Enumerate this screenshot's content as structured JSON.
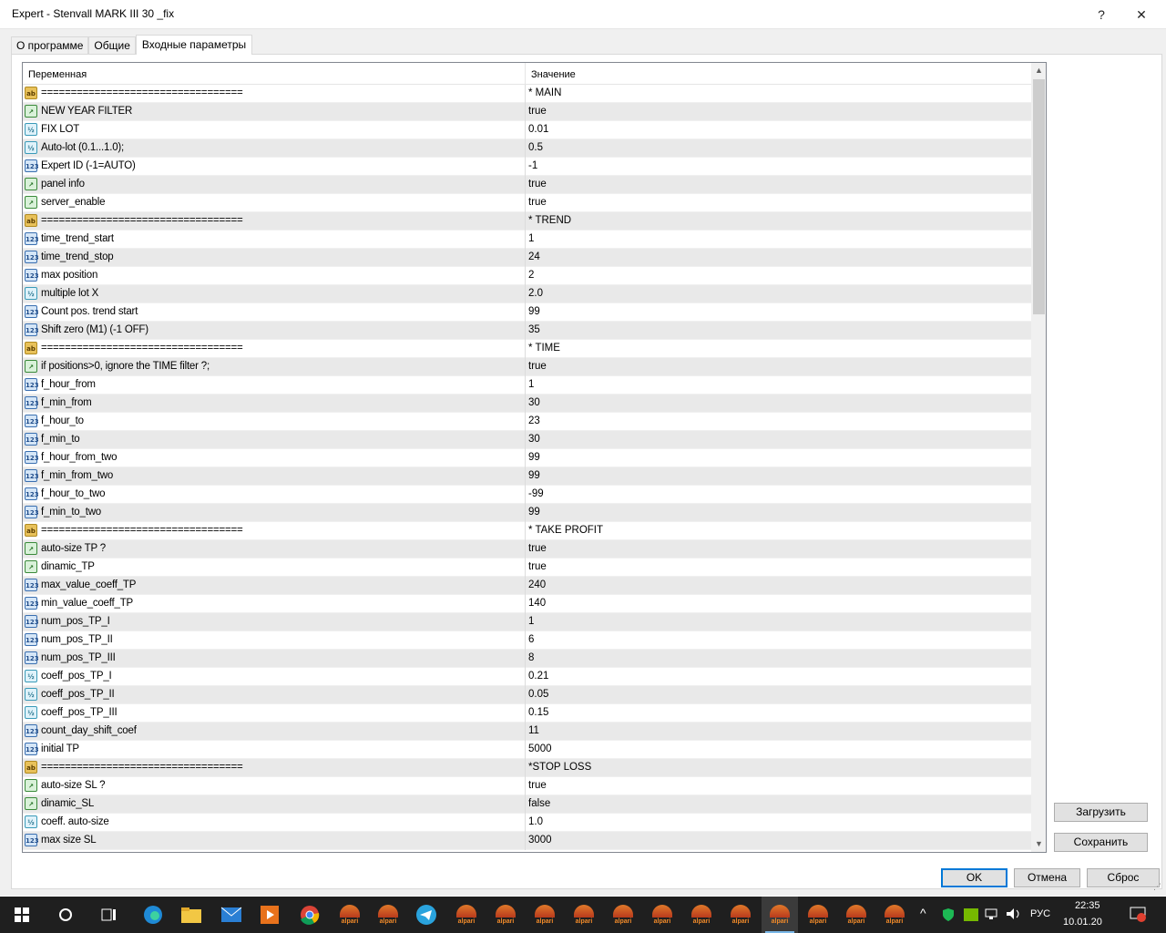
{
  "window": {
    "title": "Expert - Stenvall MARK III 30 _fix",
    "help_label": "?",
    "close_label": "✕"
  },
  "tabs": [
    {
      "label": "О программе"
    },
    {
      "label": "Общие"
    },
    {
      "label": "Входные параметры"
    }
  ],
  "grid": {
    "col_variable": "Переменная",
    "col_value": "Значение",
    "rows": [
      {
        "type": "ab",
        "name": "==================================",
        "value": "* MAIN"
      },
      {
        "type": "bool",
        "name": "NEW YEAR FILTER",
        "value": "true"
      },
      {
        "type": "dbl",
        "name": "FIX LOT",
        "value": "0.01"
      },
      {
        "type": "dbl",
        "name": "Auto-lot (0.1...1.0);",
        "value": "0.5"
      },
      {
        "type": "int",
        "name": "Expert ID (-1=AUTO)",
        "value": "-1"
      },
      {
        "type": "bool",
        "name": "panel info",
        "value": "true"
      },
      {
        "type": "bool",
        "name": "server_enable",
        "value": "true"
      },
      {
        "type": "ab",
        "name": "==================================",
        "value": "* TREND"
      },
      {
        "type": "int",
        "name": "time_trend_start",
        "value": "1"
      },
      {
        "type": "int",
        "name": "time_trend_stop",
        "value": "24"
      },
      {
        "type": "int",
        "name": "max position",
        "value": "2"
      },
      {
        "type": "dbl",
        "name": "multiple lot X",
        "value": "2.0"
      },
      {
        "type": "int",
        "name": "Count pos. trend start",
        "value": "99"
      },
      {
        "type": "int",
        "name": "Shift zero (M1) (-1 OFF)",
        "value": "35"
      },
      {
        "type": "ab",
        "name": "==================================",
        "value": "* TIME"
      },
      {
        "type": "bool",
        "name": "if positions>0, ignore the TIME filter ?;",
        "value": "true"
      },
      {
        "type": "int",
        "name": "f_hour_from",
        "value": "1"
      },
      {
        "type": "int",
        "name": "f_min_from",
        "value": "30"
      },
      {
        "type": "int",
        "name": "f_hour_to",
        "value": "23"
      },
      {
        "type": "int",
        "name": "f_min_to",
        "value": "30"
      },
      {
        "type": "int",
        "name": "f_hour_from_two",
        "value": "99"
      },
      {
        "type": "int",
        "name": "f_min_from_two",
        "value": "99"
      },
      {
        "type": "int",
        "name": "f_hour_to_two",
        "value": "-99"
      },
      {
        "type": "int",
        "name": "f_min_to_two",
        "value": "99"
      },
      {
        "type": "ab",
        "name": "==================================",
        "value": "* TAKE PROFIT"
      },
      {
        "type": "bool",
        "name": "auto-size TP ?",
        "value": "true"
      },
      {
        "type": "bool",
        "name": "dinamic_TP",
        "value": "true"
      },
      {
        "type": "int",
        "name": "max_value_coeff_TP",
        "value": "240"
      },
      {
        "type": "int",
        "name": "min_value_coeff_TP",
        "value": "140"
      },
      {
        "type": "int",
        "name": "num_pos_TP_I",
        "value": "1"
      },
      {
        "type": "int",
        "name": "num_pos_TP_II",
        "value": "6"
      },
      {
        "type": "int",
        "name": "num_pos_TP_III",
        "value": "8"
      },
      {
        "type": "dbl",
        "name": "coeff_pos_TP_I",
        "value": "0.21"
      },
      {
        "type": "dbl",
        "name": "coeff_pos_TP_II",
        "value": "0.05"
      },
      {
        "type": "dbl",
        "name": "coeff_pos_TP_III",
        "value": "0.15"
      },
      {
        "type": "int",
        "name": "count_day_shift_coef",
        "value": "11"
      },
      {
        "type": "int",
        "name": "initial TP",
        "value": "5000"
      },
      {
        "type": "ab",
        "name": "==================================",
        "value": "*STOP LOSS"
      },
      {
        "type": "bool",
        "name": "auto-size SL ?",
        "value": "true"
      },
      {
        "type": "bool",
        "name": "dinamic_SL",
        "value": "false"
      },
      {
        "type": "dbl",
        "name": "coeff. auto-size",
        "value": "1.0"
      },
      {
        "type": "int",
        "name": "max size SL",
        "value": "3000"
      }
    ]
  },
  "icons": {
    "ab": "ab",
    "bool": "↗",
    "int": "123",
    "dbl": "½"
  },
  "buttons": {
    "load": "Загрузить",
    "save": "Сохранить",
    "ok": "OK",
    "cancel": "Отмена",
    "reset": "Сброс"
  },
  "taskbar": {
    "alpari_label": "alpari",
    "lang": "РУС",
    "time": "22:35",
    "date": "10.01.20"
  }
}
